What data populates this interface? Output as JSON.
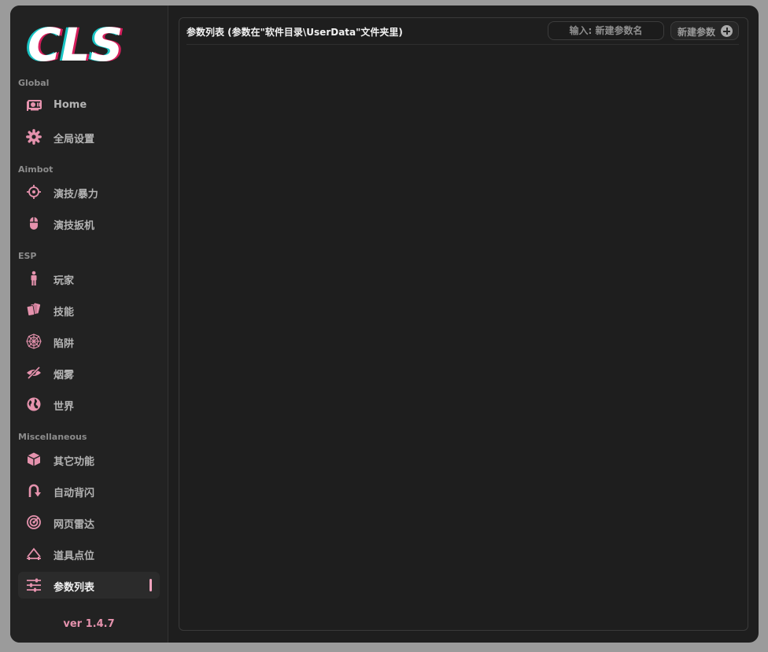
{
  "app": {
    "logo_text": "CLS",
    "version": "ver 1.4.7",
    "accent_color": "#f3a3be",
    "icon_color": "#e592ad"
  },
  "sidebar": {
    "sections": [
      {
        "title": "Global",
        "items": [
          {
            "label": "Home",
            "icon": "gpu-card-icon"
          },
          {
            "label": "全局设置",
            "icon": "gear-icon"
          }
        ]
      },
      {
        "title": "Aimbot",
        "items": [
          {
            "label": "演技/暴力",
            "icon": "crosshair-icon"
          },
          {
            "label": "演技扳机",
            "icon": "mouse-icon"
          }
        ]
      },
      {
        "title": "ESP",
        "items": [
          {
            "label": "玩家",
            "icon": "person-icon"
          },
          {
            "label": "技能",
            "icon": "cards-icon"
          },
          {
            "label": "陷阱",
            "icon": "spider-web-icon"
          },
          {
            "label": "烟雾",
            "icon": "eye-slash-icon"
          },
          {
            "label": "世界",
            "icon": "globe-icon"
          }
        ]
      },
      {
        "title": "Miscellaneous",
        "items": [
          {
            "label": "其它功能",
            "icon": "cube-icon"
          },
          {
            "label": "自动背闪",
            "icon": "u-turn-icon"
          },
          {
            "label": "网页雷达",
            "icon": "radar-icon"
          },
          {
            "label": "道具点位",
            "icon": "landmark-icon"
          },
          {
            "label": "参数列表",
            "icon": "sliders-icon",
            "active": true
          }
        ]
      }
    ]
  },
  "main": {
    "title": "参数列表 (参数在\"软件目录\\UserData\"文件夹里)",
    "search": {
      "value": "",
      "placeholder": "输入: 新建参数名"
    },
    "new_button_label": "新建参数"
  }
}
